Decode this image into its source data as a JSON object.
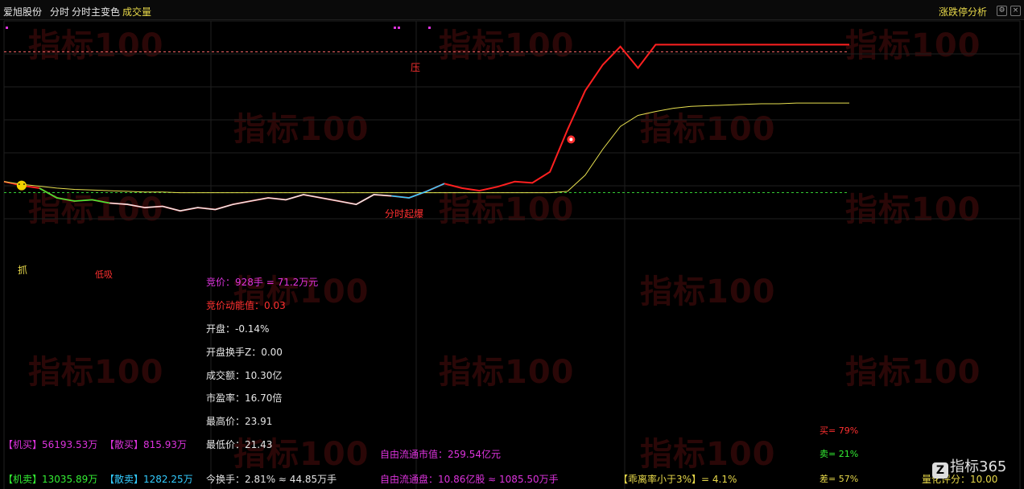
{
  "header": {
    "stock_name": "爱旭股份",
    "mode": "分时",
    "indicator": "分时主变色",
    "volume_label": "成交量",
    "right_title": "涨跌停分析",
    "btn_settings": "⚙",
    "btn_close": "×"
  },
  "watermark": "指标100",
  "chart_data": {
    "type": "line",
    "title": "",
    "xlabel": "",
    "ylabel": "",
    "x": [
      0,
      5,
      10,
      15,
      20,
      25,
      30,
      35,
      40,
      45,
      50,
      55,
      60,
      65,
      70,
      75,
      80,
      85,
      90,
      95,
      100,
      105,
      110,
      115,
      120,
      125,
      130,
      135,
      140,
      145,
      150,
      155,
      160,
      165,
      170,
      175,
      180,
      185,
      190,
      195,
      200,
      205,
      210,
      215,
      220,
      225,
      230,
      235,
      240
    ],
    "ylim": [
      20.2,
      24.3
    ],
    "series": [
      {
        "values": [
          21.8,
          21.74,
          21.7,
          21.55,
          21.5,
          21.52,
          21.47,
          21.45,
          21.4,
          21.42,
          21.35,
          21.4,
          21.37,
          21.45,
          21.5,
          21.55,
          21.52,
          21.6,
          21.55,
          21.5,
          21.45,
          21.6,
          21.58,
          21.55,
          21.65,
          21.77,
          21.7,
          21.66,
          21.72,
          21.8,
          21.78,
          21.95,
          22.6,
          23.2,
          23.6,
          23.88,
          23.55,
          23.91,
          23.91,
          23.91,
          23.91,
          23.91,
          23.91,
          23.91,
          23.91,
          23.91,
          23.91,
          23.91,
          23.91
        ],
        "color": "#ff2020"
      },
      {
        "values": [
          21.8,
          21.76,
          21.73,
          21.7,
          21.68,
          21.67,
          21.66,
          21.65,
          21.64,
          21.64,
          21.63,
          21.63,
          21.63,
          21.63,
          21.63,
          21.63,
          21.63,
          21.63,
          21.63,
          21.63,
          21.63,
          21.63,
          21.63,
          21.63,
          21.63,
          21.63,
          21.63,
          21.63,
          21.63,
          21.63,
          21.63,
          21.63,
          21.65,
          21.9,
          22.3,
          22.65,
          22.82,
          22.88,
          22.93,
          22.96,
          22.97,
          22.98,
          22.99,
          23.0,
          23.0,
          23.01,
          23.01,
          23.01,
          23.01
        ],
        "color": "#e8e050"
      }
    ],
    "reference_levels": [
      23.8,
      21.63
    ]
  },
  "annotations": {
    "grab": "抓",
    "pressure": "压",
    "breakout": "分时起爆",
    "low_tag": "低吸"
  },
  "info": {
    "auction": "竞价：928手 = 71.2万元",
    "auction_momentum": "竞价动能值：0.03",
    "open": "开盘：-0.14%",
    "open_turnover": "开盘换手Z：0.00",
    "amount": "成交额：10.30亿",
    "pe": "市盈率：16.70倍",
    "high": "最高价：23.91",
    "low": "最低价：21.43",
    "turnover": "今换手：2.81% ≈ 44.85万手"
  },
  "bottom": {
    "inst_buy": "【机买】56193.53万",
    "retail_buy": "【散买】815.93万",
    "inst_sell": "【机卖】13035.89万",
    "retail_sell": "【散卖】1282.25万",
    "float_cap": "自由流通市值：259.54亿元",
    "float_shares": "自由流通盘：10.86亿股 ≈ 1085.50万手",
    "deviation": "【乖离率小于3%】= 4.1%",
    "buy_pct": "买= 79%",
    "sell_pct": "卖= 21%",
    "diff_pct": "差= 57%",
    "quant_score": "量化评分：10.00"
  },
  "logo": {
    "text": "指标365",
    "badge": "Z"
  },
  "colors": {
    "price": "#ff2020",
    "avg": "#e8e050",
    "green": "#33ee33",
    "white": "#e6e6e6",
    "cyan": "#33ccff",
    "magenta": "#dd33dd",
    "yellow": "#e8d94a",
    "red": "#ff3030"
  }
}
